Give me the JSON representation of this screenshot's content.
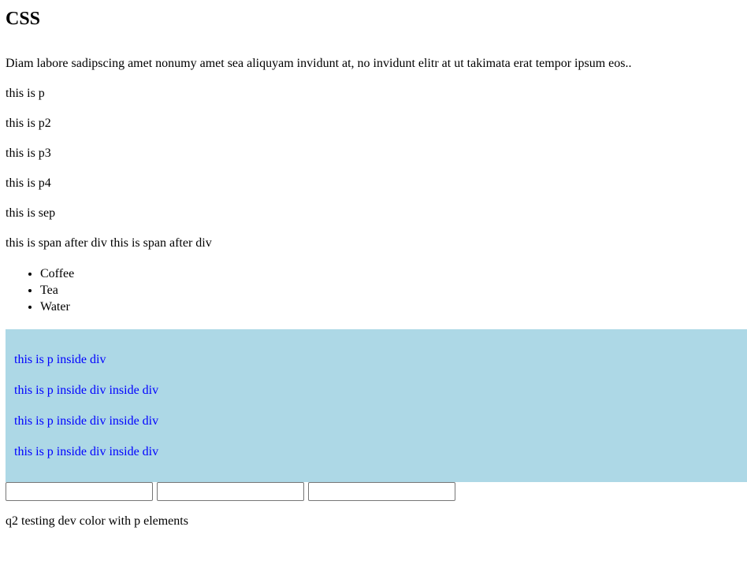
{
  "heading": "CSS",
  "intro": "Diam labore sadipscing amet nonumy amet sea aliquyam invidunt at, no invidunt elitr at ut takimata erat tempor ipsum eos..",
  "paragraphs": [
    "this is p",
    "this is p2",
    "this is p3",
    "this is p4",
    "this is sep"
  ],
  "span_line": "this is span after div this is span after div",
  "list_items": [
    "Coffee",
    "Tea",
    "Water"
  ],
  "box": {
    "background": "#add8e6",
    "text_color": "#0000ff",
    "paragraphs": [
      "this is p inside div",
      "this is p inside div inside div",
      "this is p inside div inside div",
      "this is p inside div inside div"
    ]
  },
  "inputs": [
    {
      "value": "",
      "placeholder": ""
    },
    {
      "value": "",
      "placeholder": ""
    },
    {
      "value": "",
      "placeholder": ""
    }
  ],
  "footer_text": "q2 testing dev color with p elements"
}
